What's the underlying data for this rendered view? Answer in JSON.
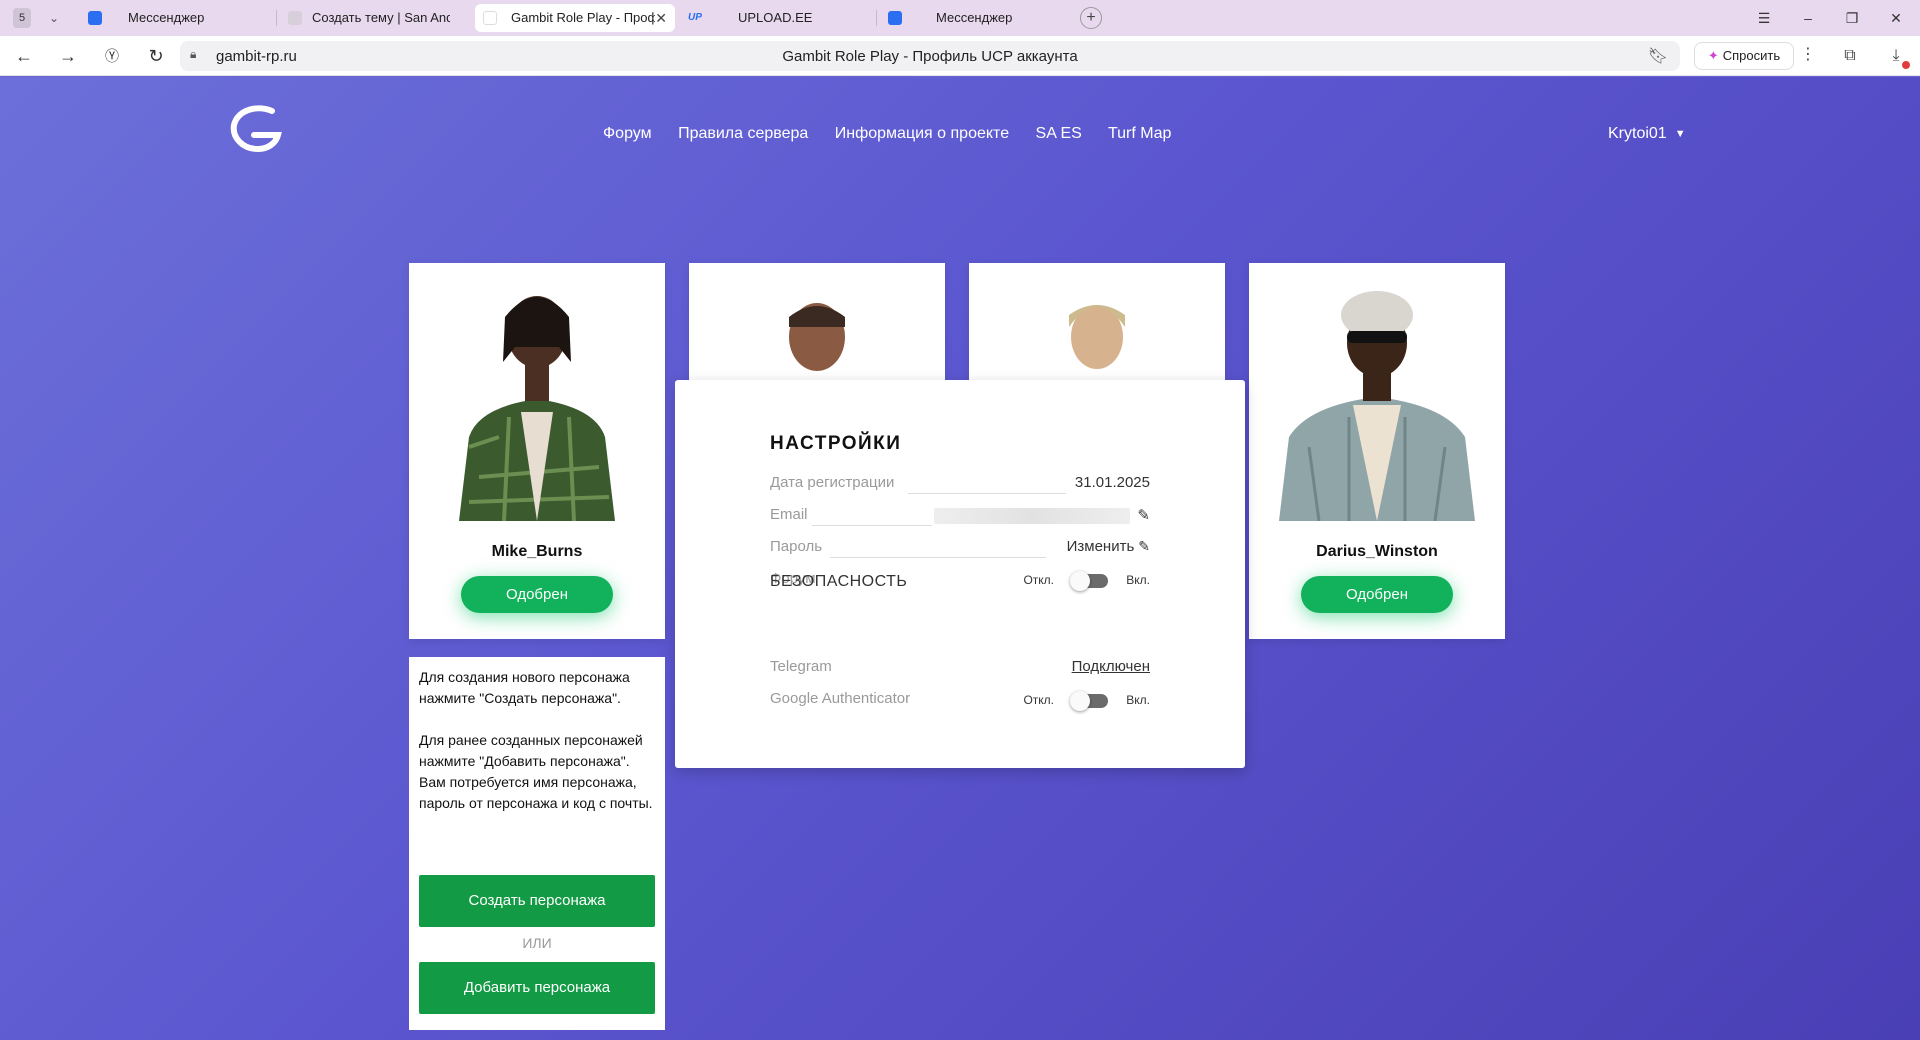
{
  "browser": {
    "tab_count": "5",
    "tabs": [
      {
        "label": "Мессенджер",
        "icon": "messenger-icon",
        "color": "#2b6ef2"
      },
      {
        "label": "Создать тему | San Andreas",
        "icon": "forum-icon",
        "color": "#c9c9c9"
      },
      {
        "label": "Gambit Role Play - Профиль",
        "icon": "gambit-icon",
        "color": "#ffffff"
      },
      {
        "label": "UPLOAD.EE",
        "icon": "upload-icon",
        "color": "#2b6ef2"
      },
      {
        "label": "Мессенджер",
        "icon": "messenger-icon",
        "color": "#2b6ef2"
      }
    ],
    "url": "gambit-rp.ru",
    "page_title": "Gambit Role Play - Профиль UCP аккаунта",
    "ask_label": "Спросить"
  },
  "site": {
    "nav": [
      "Форум",
      "Правила сервера",
      "Информация о проекте",
      "SA ES",
      "Turf Map"
    ],
    "username": "Krytoi01"
  },
  "characters": [
    {
      "name": "Mike_Burns",
      "status": "Одобрен"
    },
    {
      "name": "",
      "status": ""
    },
    {
      "name": "",
      "status": ""
    },
    {
      "name": "Darius_Winston",
      "status": "Одобрен"
    }
  ],
  "info": {
    "text": "Для создания нового персонажа нажмите \"Создать персонажа\".\n\nДля ранее созданных персонажей нажмите \"Добавить персонажа\". Вам потребуется имя персонажа, пароль от персонажа и код с почты.",
    "create_label": "Создать персонажа",
    "or_label": "ИЛИ",
    "add_label": "Добавить персонажа"
  },
  "settings": {
    "title": "НАСТРОЙКИ",
    "reg_label": "Дата регистрации",
    "reg_value": "31.01.2025",
    "email_label": "Email",
    "password_label": "Пароль",
    "password_action": "Изменить",
    "forum_label": "Форум",
    "off_label": "Откл.",
    "on_label": "Вкл.",
    "security_title": "БЕЗОПАСНОСТЬ",
    "telegram_label": "Telegram",
    "telegram_value": "Подключен",
    "ga_label": "Google Authenticator"
  },
  "colors": {
    "approved": "#12b15b",
    "primary_button": "#139a45",
    "background": "#5b56cf"
  }
}
